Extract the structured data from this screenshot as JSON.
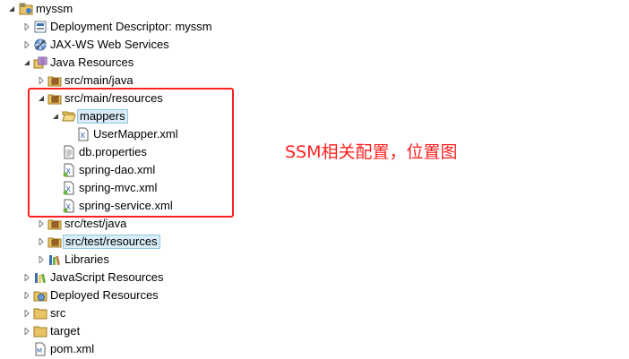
{
  "tree": {
    "root": {
      "label": "myssm",
      "icon": "maven-web-project-icon"
    },
    "deployment_descriptor": {
      "label": "Deployment Descriptor: myssm",
      "icon": "deployment-descriptor-icon"
    },
    "jaxws": {
      "label": "JAX-WS Web Services",
      "icon": "web-services-icon"
    },
    "java_resources": {
      "label": "Java Resources",
      "icon": "java-resources-icon"
    },
    "src_main_java": {
      "label": "src/main/java",
      "icon": "source-folder-icon"
    },
    "src_main_resources": {
      "label": "src/main/resources",
      "icon": "source-folder-icon"
    },
    "mappers": {
      "label": "mappers",
      "icon": "folder-open-icon"
    },
    "user_mapper": {
      "label": "UserMapper.xml",
      "icon": "xml-file-icon"
    },
    "db_properties": {
      "label": "db.properties",
      "icon": "properties-file-icon"
    },
    "spring_dao": {
      "label": "spring-dao.xml",
      "icon": "spring-xml-file-icon"
    },
    "spring_mvc": {
      "label": "spring-mvc.xml",
      "icon": "spring-xml-file-icon"
    },
    "spring_service": {
      "label": "spring-service.xml",
      "icon": "spring-xml-file-icon"
    },
    "src_test_java": {
      "label": "src/test/java",
      "icon": "source-folder-icon"
    },
    "src_test_resources": {
      "label": "src/test/resources",
      "icon": "source-folder-icon"
    },
    "libraries": {
      "label": "Libraries",
      "icon": "libraries-icon"
    },
    "javascript_resources": {
      "label": "JavaScript Resources",
      "icon": "javascript-resources-icon"
    },
    "deployed_resources": {
      "label": "Deployed Resources",
      "icon": "deployed-resources-icon"
    },
    "src": {
      "label": "src",
      "icon": "folder-icon"
    },
    "target": {
      "label": "target",
      "icon": "folder-icon"
    },
    "pom": {
      "label": "pom.xml",
      "icon": "maven-pom-icon"
    }
  },
  "annotation": {
    "text": "SSM相关配置，位置图",
    "color": "#ff2020"
  },
  "colors": {
    "highlight_border": "#ff2020",
    "selection_bg": "#d9ecf7",
    "selection_border": "#8fc6e6"
  }
}
